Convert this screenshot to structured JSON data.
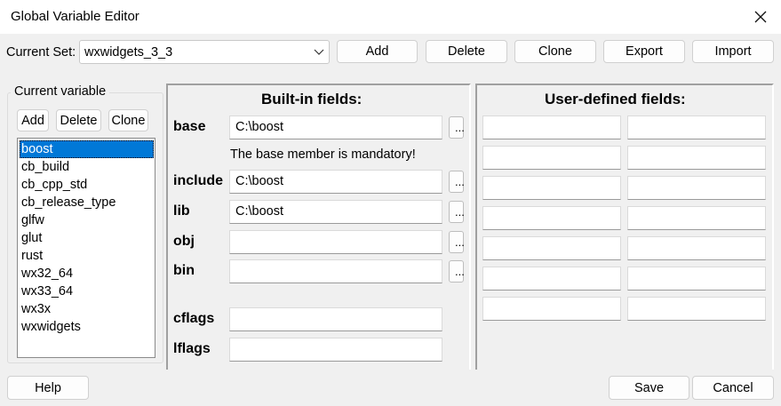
{
  "window": {
    "title": "Global Variable Editor",
    "close_glyph": "×"
  },
  "set": {
    "label": "Current Set:",
    "value": "wxwidgets_3_3",
    "buttons": {
      "add": "Add",
      "delete": "Delete",
      "clone": "Clone",
      "export": "Export",
      "import": "Import"
    }
  },
  "current_variable": {
    "title": "Current variable",
    "buttons": {
      "add": "Add",
      "delete": "Delete",
      "clone": "Clone"
    },
    "items": [
      "boost",
      "cb_build",
      "cb_cpp_std",
      "cb_release_type",
      "glfw",
      "glut",
      "rust",
      "wx32_64",
      "wx33_64",
      "wx3x",
      "wxwidgets"
    ],
    "selected_index": 0
  },
  "builtin": {
    "title": "Built-in fields:",
    "base_note": "The base member is mandatory!",
    "browse_label": "...",
    "fields": {
      "base": {
        "label": "base",
        "value": "C:\\boost"
      },
      "include": {
        "label": "include",
        "value": "C:\\boost"
      },
      "lib": {
        "label": "lib",
        "value": "C:\\boost"
      },
      "obj": {
        "label": "obj",
        "value": ""
      },
      "bin": {
        "label": "bin",
        "value": ""
      },
      "cflags": {
        "label": "cflags",
        "value": ""
      },
      "lflags": {
        "label": "lflags",
        "value": ""
      }
    }
  },
  "user_defined": {
    "title": "User-defined fields:",
    "rows": 7
  },
  "footer": {
    "help": "Help",
    "save": "Save",
    "cancel": "Cancel"
  },
  "colors": {
    "selection": "#0078d7",
    "background": "#f0f0f0"
  }
}
